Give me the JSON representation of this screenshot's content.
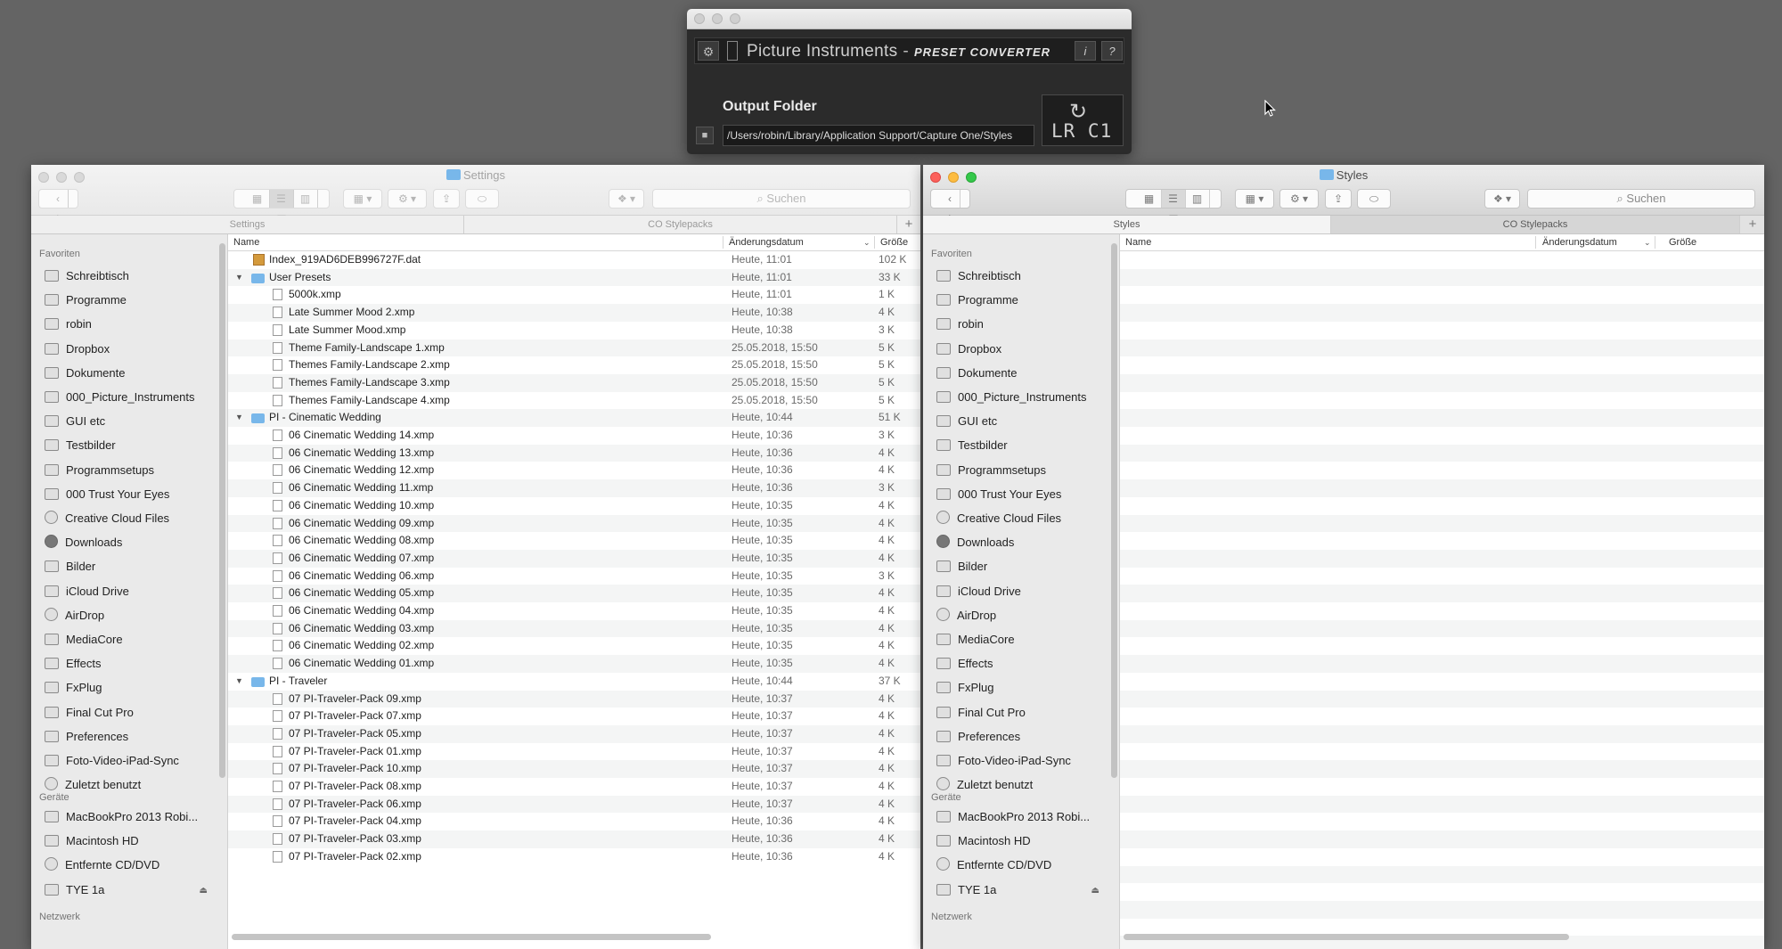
{
  "converter": {
    "brand": "Picture Instruments",
    "separator": "-",
    "product": "PRESET CONVERTER",
    "gear_icon": "⚙",
    "info_label": "i",
    "help_label": "?",
    "folder_icon": "■",
    "output_label": "Output Folder",
    "output_path": "/Users/robin/Library/Application Support/Capture One/Styles",
    "convert_label": "LR C1",
    "convert_icon": "↻"
  },
  "left_window": {
    "title": "Settings",
    "search_placeholder": "Suchen",
    "tabs": [
      "Settings",
      "CO Stylepacks"
    ],
    "columns": {
      "name": "Name",
      "date": "Änderungsdatum",
      "size": "Größe"
    },
    "rows": [
      {
        "name": "Index_919AD6DEB996727F.dat",
        "date": "Heute, 11:01",
        "size": "102 K",
        "kind": "dat",
        "level": 0
      },
      {
        "name": "User Presets",
        "date": "Heute, 11:01",
        "size": "33 K",
        "kind": "folder",
        "level": 0
      },
      {
        "name": "5000k.xmp",
        "date": "Heute, 11:01",
        "size": "1 K",
        "kind": "file",
        "level": 1
      },
      {
        "name": "Late Summer Mood 2.xmp",
        "date": "Heute, 10:38",
        "size": "4 K",
        "kind": "file",
        "level": 1
      },
      {
        "name": "Late Summer Mood.xmp",
        "date": "Heute, 10:38",
        "size": "3 K",
        "kind": "file",
        "level": 1
      },
      {
        "name": "Theme Family-Landscape 1.xmp",
        "date": "25.05.2018, 15:50",
        "size": "5 K",
        "kind": "file",
        "level": 1
      },
      {
        "name": "Themes Family-Landscape 2.xmp",
        "date": "25.05.2018, 15:50",
        "size": "5 K",
        "kind": "file",
        "level": 1
      },
      {
        "name": "Themes Family-Landscape 3.xmp",
        "date": "25.05.2018, 15:50",
        "size": "5 K",
        "kind": "file",
        "level": 1
      },
      {
        "name": "Themes Family-Landscape 4.xmp",
        "date": "25.05.2018, 15:50",
        "size": "5 K",
        "kind": "file",
        "level": 1
      },
      {
        "name": "PI - Cinematic Wedding",
        "date": "Heute, 10:44",
        "size": "51 K",
        "kind": "folder",
        "level": 0
      },
      {
        "name": "06 Cinematic Wedding 14.xmp",
        "date": "Heute, 10:36",
        "size": "3 K",
        "kind": "file",
        "level": 1
      },
      {
        "name": "06 Cinematic Wedding 13.xmp",
        "date": "Heute, 10:36",
        "size": "4 K",
        "kind": "file",
        "level": 1
      },
      {
        "name": "06 Cinematic Wedding 12.xmp",
        "date": "Heute, 10:36",
        "size": "4 K",
        "kind": "file",
        "level": 1
      },
      {
        "name": "06 Cinematic Wedding 11.xmp",
        "date": "Heute, 10:36",
        "size": "3 K",
        "kind": "file",
        "level": 1
      },
      {
        "name": "06 Cinematic Wedding 10.xmp",
        "date": "Heute, 10:35",
        "size": "4 K",
        "kind": "file",
        "level": 1
      },
      {
        "name": "06 Cinematic Wedding 09.xmp",
        "date": "Heute, 10:35",
        "size": "4 K",
        "kind": "file",
        "level": 1
      },
      {
        "name": "06 Cinematic Wedding 08.xmp",
        "date": "Heute, 10:35",
        "size": "4 K",
        "kind": "file",
        "level": 1
      },
      {
        "name": "06 Cinematic Wedding 07.xmp",
        "date": "Heute, 10:35",
        "size": "4 K",
        "kind": "file",
        "level": 1
      },
      {
        "name": "06 Cinematic Wedding 06.xmp",
        "date": "Heute, 10:35",
        "size": "3 K",
        "kind": "file",
        "level": 1
      },
      {
        "name": "06 Cinematic Wedding 05.xmp",
        "date": "Heute, 10:35",
        "size": "4 K",
        "kind": "file",
        "level": 1
      },
      {
        "name": "06 Cinematic Wedding 04.xmp",
        "date": "Heute, 10:35",
        "size": "4 K",
        "kind": "file",
        "level": 1
      },
      {
        "name": "06 Cinematic Wedding 03.xmp",
        "date": "Heute, 10:35",
        "size": "4 K",
        "kind": "file",
        "level": 1
      },
      {
        "name": "06 Cinematic Wedding 02.xmp",
        "date": "Heute, 10:35",
        "size": "4 K",
        "kind": "file",
        "level": 1
      },
      {
        "name": "06 Cinematic Wedding 01.xmp",
        "date": "Heute, 10:35",
        "size": "4 K",
        "kind": "file",
        "level": 1
      },
      {
        "name": "PI - Traveler",
        "date": "Heute, 10:44",
        "size": "37 K",
        "kind": "folder",
        "level": 0
      },
      {
        "name": "07 PI-Traveler-Pack 09.xmp",
        "date": "Heute, 10:37",
        "size": "4 K",
        "kind": "file",
        "level": 1
      },
      {
        "name": "07 PI-Traveler-Pack 07.xmp",
        "date": "Heute, 10:37",
        "size": "4 K",
        "kind": "file",
        "level": 1
      },
      {
        "name": "07 PI-Traveler-Pack 05.xmp",
        "date": "Heute, 10:37",
        "size": "4 K",
        "kind": "file",
        "level": 1
      },
      {
        "name": "07 PI-Traveler-Pack 01.xmp",
        "date": "Heute, 10:37",
        "size": "4 K",
        "kind": "file",
        "level": 1
      },
      {
        "name": "07 PI-Traveler-Pack 10.xmp",
        "date": "Heute, 10:37",
        "size": "4 K",
        "kind": "file",
        "level": 1
      },
      {
        "name": "07 PI-Traveler-Pack 08.xmp",
        "date": "Heute, 10:37",
        "size": "4 K",
        "kind": "file",
        "level": 1
      },
      {
        "name": "07 PI-Traveler-Pack 06.xmp",
        "date": "Heute, 10:37",
        "size": "4 K",
        "kind": "file",
        "level": 1
      },
      {
        "name": "07 PI-Traveler-Pack 04.xmp",
        "date": "Heute, 10:36",
        "size": "4 K",
        "kind": "file",
        "level": 1
      },
      {
        "name": "07 PI-Traveler-Pack 03.xmp",
        "date": "Heute, 10:36",
        "size": "4 K",
        "kind": "file",
        "level": 1
      },
      {
        "name": "07 PI-Traveler-Pack 02.xmp",
        "date": "Heute, 10:36",
        "size": "4 K",
        "kind": "file",
        "level": 1
      }
    ]
  },
  "right_window": {
    "title": "Styles",
    "search_placeholder": "Suchen",
    "tabs": [
      "Styles",
      "CO Stylepacks"
    ],
    "columns": {
      "name": "Name",
      "date": "Änderungsdatum",
      "size": "Größe"
    }
  },
  "sidebar": {
    "favorites_label": "Favoriten",
    "devices_label": "Geräte",
    "network_label": "Netzwerk",
    "favorites": [
      {
        "label": "Schreibtisch",
        "icon": "desktop-icon"
      },
      {
        "label": "Programme",
        "icon": "applications-icon"
      },
      {
        "label": "robin",
        "icon": "home-icon"
      },
      {
        "label": "Dropbox",
        "icon": "dropbox-icon"
      },
      {
        "label": "Dokumente",
        "icon": "documents-icon"
      },
      {
        "label": "000_Picture_Instruments",
        "icon": "folder-icon"
      },
      {
        "label": "GUI etc",
        "icon": "folder-icon"
      },
      {
        "label": "Testbilder",
        "icon": "folder-icon"
      },
      {
        "label": "Programmsetups",
        "icon": "folder-icon"
      },
      {
        "label": "000 Trust Your Eyes",
        "icon": "folder-icon"
      },
      {
        "label": "Creative Cloud Files",
        "icon": "creative-cloud-icon"
      },
      {
        "label": "Downloads",
        "icon": "downloads-icon"
      },
      {
        "label": "Bilder",
        "icon": "camera-icon"
      },
      {
        "label": "iCloud Drive",
        "icon": "cloud-icon"
      },
      {
        "label": "AirDrop",
        "icon": "airdrop-icon"
      },
      {
        "label": "MediaCore",
        "icon": "folder-icon"
      },
      {
        "label": "Effects",
        "icon": "folder-icon"
      },
      {
        "label": "FxPlug",
        "icon": "folder-icon"
      },
      {
        "label": "Final Cut Pro",
        "icon": "folder-icon"
      },
      {
        "label": "Preferences",
        "icon": "folder-icon"
      },
      {
        "label": "Foto-Video-iPad-Sync",
        "icon": "folder-icon"
      },
      {
        "label": "Zuletzt benutzt",
        "icon": "recents-icon"
      }
    ],
    "devices": [
      {
        "label": "MacBookPro 2013 Robi...",
        "icon": "laptop-icon"
      },
      {
        "label": "Macintosh HD",
        "icon": "disk-icon"
      },
      {
        "label": "Entfernte CD/DVD",
        "icon": "cd-icon"
      },
      {
        "label": "TYE 1a",
        "icon": "drive-icon"
      }
    ]
  }
}
